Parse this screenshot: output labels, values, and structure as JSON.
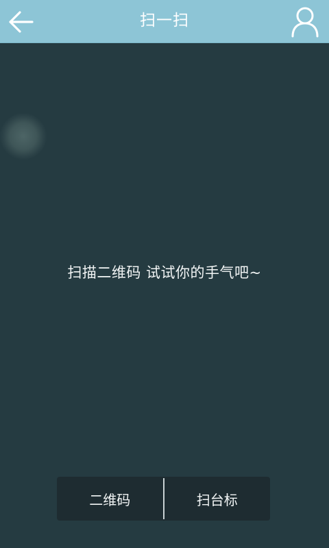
{
  "header": {
    "title": "扫一扫",
    "back_icon": "arrow-left-icon",
    "profile_icon": "user-icon",
    "background_color": "#8dc5d6"
  },
  "main": {
    "hint": "扫描二维码 试试你的手气吧~",
    "background_color": "#253b41"
  },
  "mode_switch": {
    "options": [
      {
        "label": "二维码"
      },
      {
        "label": "扫台标"
      }
    ]
  }
}
